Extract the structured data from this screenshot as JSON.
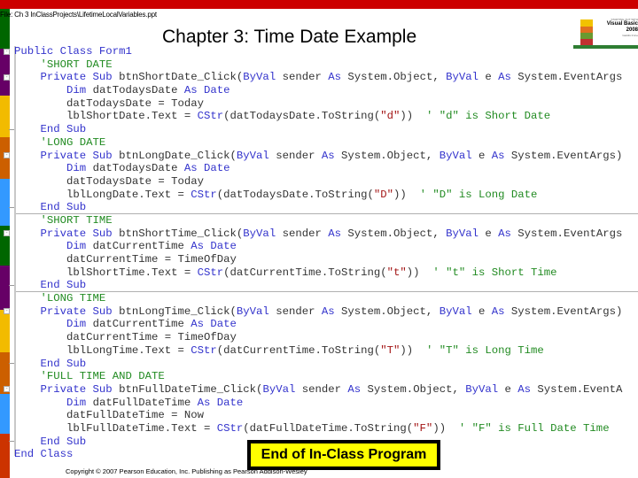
{
  "header": {
    "file_path": "File:  Ch 3 InClassProjects\\LifetimeLocalVariables.ppt",
    "title": "Chapter 3: Time Date Example"
  },
  "logo": {
    "tagline": "STARTING OUT WITH",
    "product_line1": "Visual Basic",
    "product_line2": "2008",
    "subtext": "Gaddis  Irvine"
  },
  "colors": {
    "top_bar": "#cc0000",
    "strip_bands": [
      "#006600",
      "#660066",
      "#f2bb00",
      "#cc5f00",
      "#3399ff",
      "#006600",
      "#660066",
      "#f2bb00",
      "#cc5f00",
      "#3399ff",
      "#cc3300"
    ],
    "keyword": "#3333cc",
    "comment": "#228b22",
    "string": "#a31515",
    "callout_bg": "#ffff00"
  },
  "code": {
    "lines": [
      [
        {
          "t": "Public Class Form1",
          "c": "kw"
        }
      ],
      [
        {
          "t": "    'SHORT DATE",
          "c": "cm"
        }
      ],
      [
        {
          "t": "    Private Sub ",
          "c": "kw"
        },
        {
          "t": "btnShortDate_Click(",
          "c": ""
        },
        {
          "t": "ByVal",
          "c": "kw"
        },
        {
          "t": " sender ",
          "c": ""
        },
        {
          "t": "As",
          "c": "kw"
        },
        {
          "t": " System.Object, ",
          "c": ""
        },
        {
          "t": "ByVal",
          "c": "kw"
        },
        {
          "t": " e ",
          "c": ""
        },
        {
          "t": "As",
          "c": "kw"
        },
        {
          "t": " System.EventArgs",
          "c": ""
        }
      ],
      [
        {
          "t": "        Dim ",
          "c": "kw"
        },
        {
          "t": "datTodaysDate ",
          "c": ""
        },
        {
          "t": "As Date",
          "c": "kw"
        }
      ],
      [
        {
          "t": "        datTodaysDate = Today",
          "c": ""
        }
      ],
      [
        {
          "t": "        lblShortDate.Text = ",
          "c": ""
        },
        {
          "t": "CStr",
          "c": "kw"
        },
        {
          "t": "(datTodaysDate.ToString(",
          "c": ""
        },
        {
          "t": "\"d\"",
          "c": "st"
        },
        {
          "t": "))  ",
          "c": ""
        },
        {
          "t": "' \"d\" is Short Date",
          "c": "cm"
        }
      ],
      [
        {
          "t": "    End Sub",
          "c": "kw"
        }
      ],
      [
        {
          "t": "    'LONG DATE",
          "c": "cm"
        }
      ],
      [
        {
          "t": "    Private Sub ",
          "c": "kw"
        },
        {
          "t": "btnLongDate_Click(",
          "c": ""
        },
        {
          "t": "ByVal",
          "c": "kw"
        },
        {
          "t": " sender ",
          "c": ""
        },
        {
          "t": "As",
          "c": "kw"
        },
        {
          "t": " System.Object, ",
          "c": ""
        },
        {
          "t": "ByVal",
          "c": "kw"
        },
        {
          "t": " e ",
          "c": ""
        },
        {
          "t": "As",
          "c": "kw"
        },
        {
          "t": " System.EventArgs)",
          "c": ""
        }
      ],
      [
        {
          "t": "        Dim ",
          "c": "kw"
        },
        {
          "t": "datTodaysDate ",
          "c": ""
        },
        {
          "t": "As Date",
          "c": "kw"
        }
      ],
      [
        {
          "t": "        datTodaysDate = Today",
          "c": ""
        }
      ],
      [
        {
          "t": "        lblLongDate.Text = ",
          "c": ""
        },
        {
          "t": "CStr",
          "c": "kw"
        },
        {
          "t": "(datTodaysDate.ToString(",
          "c": ""
        },
        {
          "t": "\"D\"",
          "c": "st"
        },
        {
          "t": "))  ",
          "c": ""
        },
        {
          "t": "' \"D\" is Long Date",
          "c": "cm"
        }
      ],
      [
        {
          "t": "    End Sub",
          "c": "kw"
        }
      ],
      [
        {
          "t": "    'SHORT TIME",
          "c": "cm"
        }
      ],
      [
        {
          "t": "    Private Sub ",
          "c": "kw"
        },
        {
          "t": "btnShortTime_Click(",
          "c": ""
        },
        {
          "t": "ByVal",
          "c": "kw"
        },
        {
          "t": " sender ",
          "c": ""
        },
        {
          "t": "As",
          "c": "kw"
        },
        {
          "t": " System.Object, ",
          "c": ""
        },
        {
          "t": "ByVal",
          "c": "kw"
        },
        {
          "t": " e ",
          "c": ""
        },
        {
          "t": "As",
          "c": "kw"
        },
        {
          "t": " System.EventArgs",
          "c": ""
        }
      ],
      [
        {
          "t": "        Dim ",
          "c": "kw"
        },
        {
          "t": "datCurrentTime ",
          "c": ""
        },
        {
          "t": "As Date",
          "c": "kw"
        }
      ],
      [
        {
          "t": "        datCurrentTime = TimeOfDay",
          "c": ""
        }
      ],
      [
        {
          "t": "        lblShortTime.Text = ",
          "c": ""
        },
        {
          "t": "CStr",
          "c": "kw"
        },
        {
          "t": "(datCurrentTime.ToString(",
          "c": ""
        },
        {
          "t": "\"t\"",
          "c": "st"
        },
        {
          "t": "))  ",
          "c": ""
        },
        {
          "t": "' \"t\" is Short Time",
          "c": "cm"
        }
      ],
      [
        {
          "t": "    End Sub",
          "c": "kw"
        }
      ],
      [
        {
          "t": "    'LONG TIME",
          "c": "cm"
        }
      ],
      [
        {
          "t": "    Private Sub ",
          "c": "kw"
        },
        {
          "t": "btnLongTime_Click(",
          "c": ""
        },
        {
          "t": "ByVal",
          "c": "kw"
        },
        {
          "t": " sender ",
          "c": ""
        },
        {
          "t": "As",
          "c": "kw"
        },
        {
          "t": " System.Object, ",
          "c": ""
        },
        {
          "t": "ByVal",
          "c": "kw"
        },
        {
          "t": " e ",
          "c": ""
        },
        {
          "t": "As",
          "c": "kw"
        },
        {
          "t": " System.EventArgs)",
          "c": ""
        }
      ],
      [
        {
          "t": "        Dim ",
          "c": "kw"
        },
        {
          "t": "datCurrentTime ",
          "c": ""
        },
        {
          "t": "As Date",
          "c": "kw"
        }
      ],
      [
        {
          "t": "        datCurrentTime = TimeOfDay",
          "c": ""
        }
      ],
      [
        {
          "t": "        lblLongTime.Text = ",
          "c": ""
        },
        {
          "t": "CStr",
          "c": "kw"
        },
        {
          "t": "(datCurrentTime.ToString(",
          "c": ""
        },
        {
          "t": "\"T\"",
          "c": "st"
        },
        {
          "t": "))  ",
          "c": ""
        },
        {
          "t": "' \"T\" is Long Time",
          "c": "cm"
        }
      ],
      [
        {
          "t": "    End Sub",
          "c": "kw"
        }
      ],
      [
        {
          "t": "    'FULL TIME AND DATE",
          "c": "cm"
        }
      ],
      [
        {
          "t": "    Private Sub ",
          "c": "kw"
        },
        {
          "t": "btnFullDateTime_Click(",
          "c": ""
        },
        {
          "t": "ByVal",
          "c": "kw"
        },
        {
          "t": " sender ",
          "c": ""
        },
        {
          "t": "As",
          "c": "kw"
        },
        {
          "t": " System.Object, ",
          "c": ""
        },
        {
          "t": "ByVal",
          "c": "kw"
        },
        {
          "t": " e ",
          "c": ""
        },
        {
          "t": "As",
          "c": "kw"
        },
        {
          "t": " System.EventA",
          "c": ""
        }
      ],
      [
        {
          "t": "        Dim ",
          "c": "kw"
        },
        {
          "t": "datFullDateTime ",
          "c": ""
        },
        {
          "t": "As Date",
          "c": "kw"
        }
      ],
      [
        {
          "t": "        datFullDateTime = Now",
          "c": ""
        }
      ],
      [
        {
          "t": "        lblFullDateTime.Text = ",
          "c": ""
        },
        {
          "t": "CStr",
          "c": "kw"
        },
        {
          "t": "(datFullDateTime.ToString(",
          "c": ""
        },
        {
          "t": "\"F\"",
          "c": "st"
        },
        {
          "t": "))  ",
          "c": ""
        },
        {
          "t": "' \"F\" is Full Date Time",
          "c": "cm"
        }
      ],
      [
        {
          "t": "    End Sub",
          "c": "kw"
        }
      ],
      [
        {
          "t": "End Class",
          "c": "kw"
        }
      ]
    ]
  },
  "callout": {
    "label": "End of In-Class Program"
  },
  "footer": {
    "copyright": "Copyright © 2007 Pearson Education, Inc. Publishing as Pearson Addison-Wesley"
  }
}
